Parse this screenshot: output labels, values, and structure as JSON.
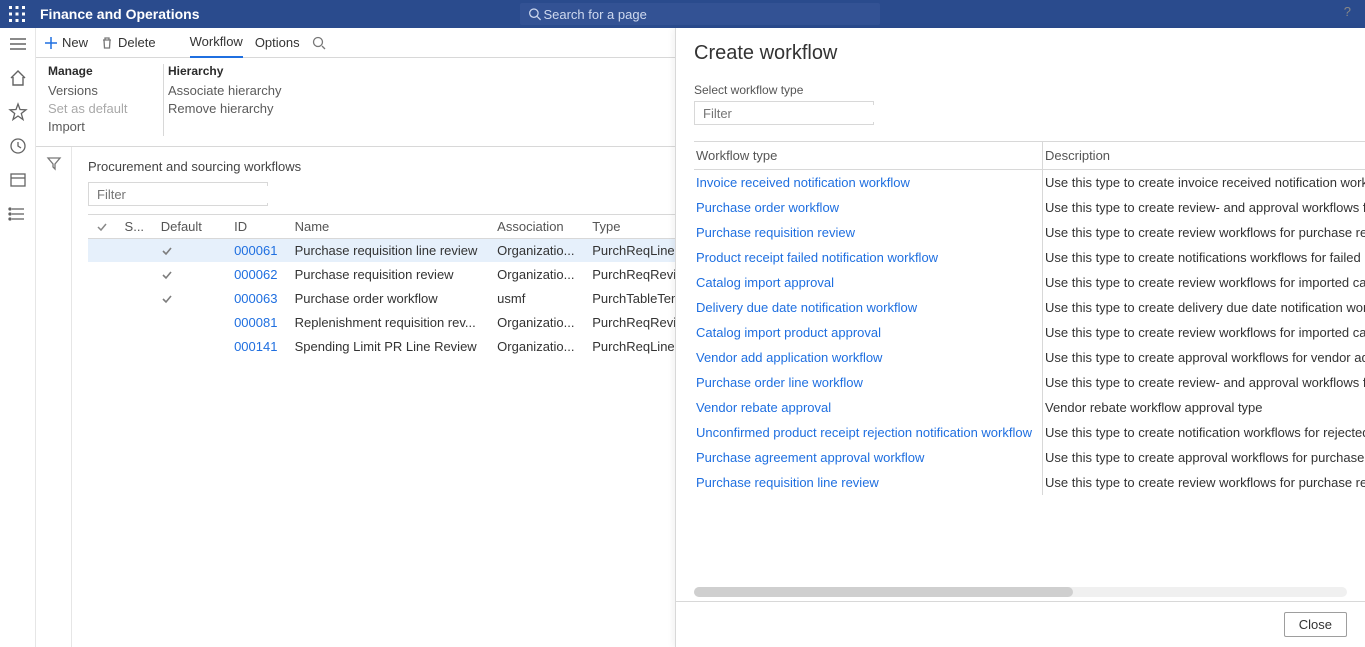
{
  "brand": "Finance and Operations",
  "search": {
    "placeholder": "Search for a page"
  },
  "help_icon": "?",
  "action_pane": {
    "new": "New",
    "delete": "Delete",
    "workflow": "Workflow",
    "options": "Options"
  },
  "subgroups": {
    "manage": {
      "title": "Manage",
      "versions": "Versions",
      "set_default": "Set as default",
      "import": "Import"
    },
    "hierarchy": {
      "title": "Hierarchy",
      "associate": "Associate hierarchy",
      "remove": "Remove hierarchy"
    }
  },
  "list": {
    "title": "Procurement and sourcing workflows",
    "filter_placeholder": "Filter",
    "headers": {
      "s": "S...",
      "default": "Default",
      "id": "ID",
      "name": "Name",
      "association": "Association",
      "type": "Type"
    },
    "rows": [
      {
        "default": true,
        "id": "000061",
        "name": "Purchase requisition line review",
        "association": "Organizatio...",
        "type": "PurchReqLineReview",
        "selected": true
      },
      {
        "default": true,
        "id": "000062",
        "name": "Purchase requisition review",
        "association": "Organizatio...",
        "type": "PurchReqReview"
      },
      {
        "default": true,
        "id": "000063",
        "name": "Purchase order workflow",
        "association": "usmf",
        "type": "PurchTableTemplate"
      },
      {
        "default": false,
        "id": "000081",
        "name": "Replenishment requisition rev...",
        "association": "Organizatio...",
        "type": "PurchReqReview"
      },
      {
        "default": false,
        "id": "000141",
        "name": "Spending Limit PR Line Review",
        "association": "Organizatio...",
        "type": "PurchReqLineReview"
      }
    ]
  },
  "dialog": {
    "title": "Create workflow",
    "select_label": "Select workflow type",
    "filter_placeholder": "Filter",
    "headers": {
      "type": "Workflow type",
      "desc": "Description"
    },
    "rows": [
      {
        "type": "Invoice received notification workflow",
        "desc": "Use this type to create invoice received notification workflow"
      },
      {
        "type": "Purchase order workflow",
        "desc": "Use this type to create review- and approval workflows for p"
      },
      {
        "type": "Purchase requisition review",
        "desc": "Use this type to create review workflows for purchase requis"
      },
      {
        "type": "Product receipt failed notification workflow",
        "desc": "Use this type to create notifications workflows for failed pro"
      },
      {
        "type": "Catalog import approval",
        "desc": "Use this type to create review workflows for imported catalo"
      },
      {
        "type": "Delivery due date notification workflow",
        "desc": "Use this type to create delivery due date notification workflo"
      },
      {
        "type": "Catalog import product approval",
        "desc": "Use this type to create review workflows for imported catalo"
      },
      {
        "type": "Vendor add application workflow",
        "desc": "Use this type to create approval workflows for vendor add a"
      },
      {
        "type": "Purchase order line workflow",
        "desc": "Use this type to create review- and approval workflows for p"
      },
      {
        "type": "Vendor rebate approval",
        "desc": "Vendor rebate workflow approval type"
      },
      {
        "type": "Unconfirmed product receipt rejection notification workflow",
        "desc": "Use this type to create notification workflows for rejected un"
      },
      {
        "type": "Purchase agreement approval workflow",
        "desc": "Use this type to create approval workflows for purchase agr"
      },
      {
        "type": "Purchase requisition line review",
        "desc": "Use this type to create review workflows for purchase requis"
      }
    ],
    "close": "Close"
  }
}
